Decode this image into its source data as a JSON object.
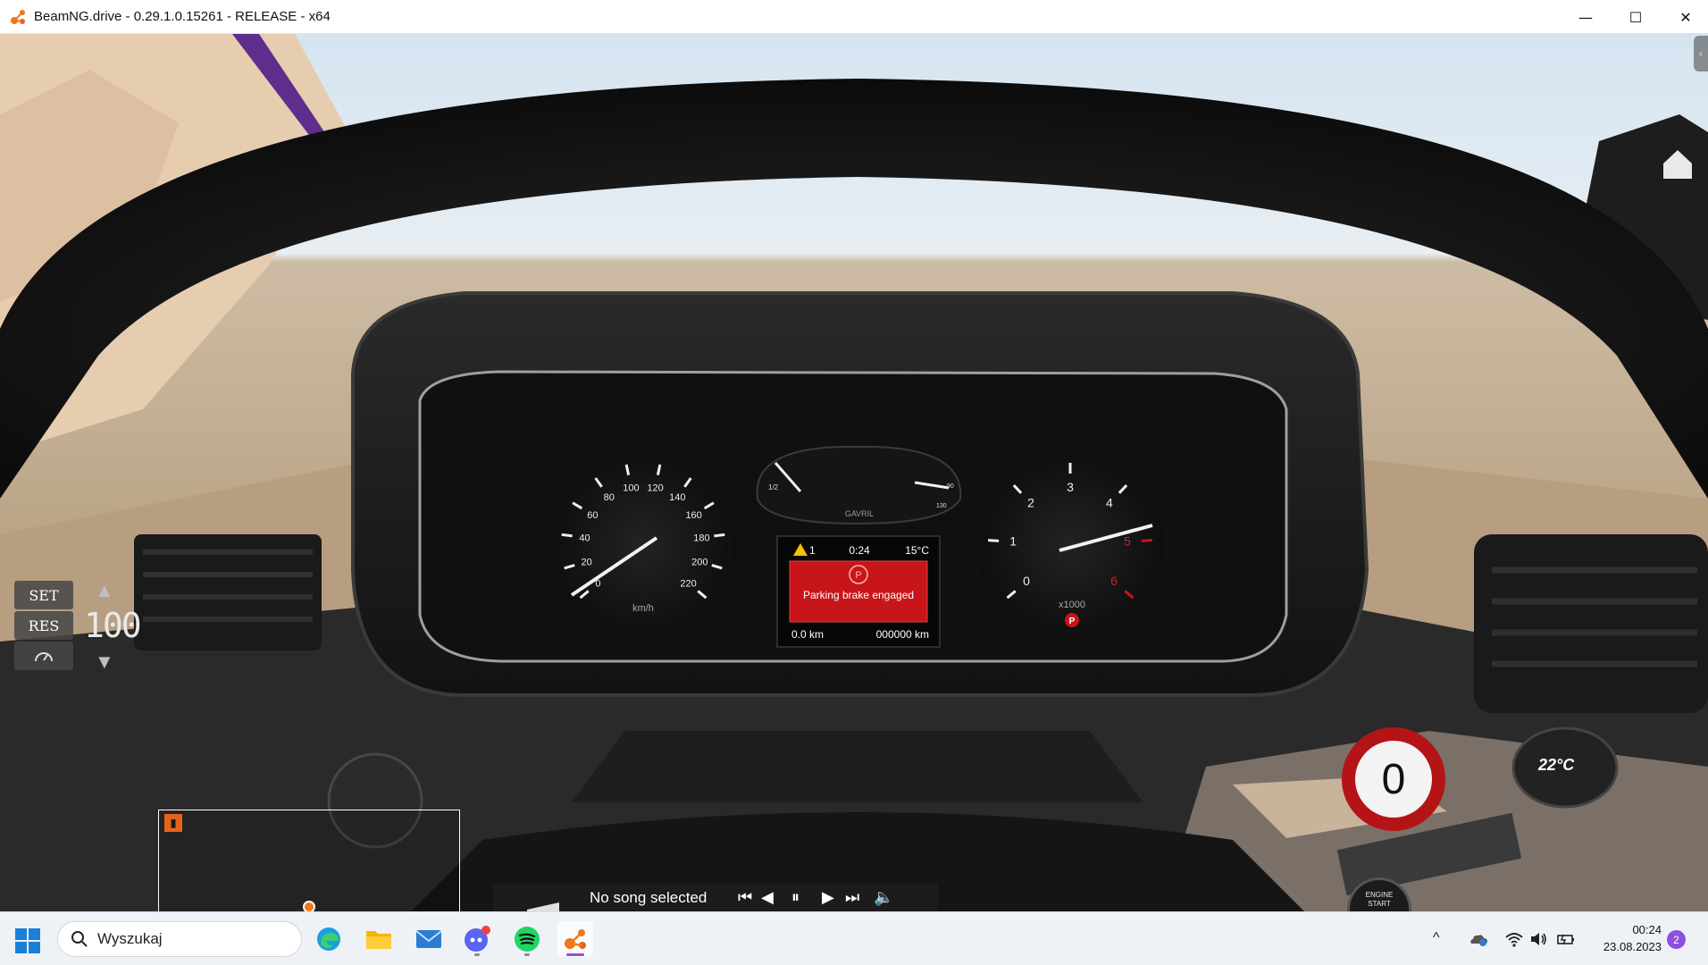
{
  "window": {
    "title": "BeamNG.drive - 0.29.1.0.15261 - RELEASE - x64",
    "minimize_glyph": "—",
    "maximize_glyph": "☐",
    "close_glyph": "✕"
  },
  "cluster": {
    "speedo_ticks": [
      "0",
      "20",
      "40",
      "60",
      "80",
      "100",
      "120",
      "140",
      "160",
      "180",
      "200",
      "220"
    ],
    "speedo_unit": "km/h",
    "tacho_ticks": [
      "0",
      "1",
      "2",
      "3",
      "4",
      "5",
      "6"
    ],
    "tacho_unit": "x1000",
    "mini_gauge_brand": "GAVRIL",
    "fuel_half": "1/2",
    "temp_max": "90",
    "temp_hot": "130",
    "display": {
      "warning_count": "1",
      "time": "0:24",
      "temperature": "15°C",
      "message": "Parking brake engaged",
      "trip": "0.0 km",
      "odometer": "000000 km"
    },
    "parking_symbol": "P"
  },
  "cruise_control": {
    "set_label": "SET",
    "res_label": "RES",
    "speed": "100",
    "up_arrow": "▲",
    "down_arrow": "▼"
  },
  "climate": {
    "temp_label": "22°C"
  },
  "music": {
    "song": "No song selected"
  },
  "speed_limit": {
    "value": "0"
  },
  "engine": {
    "line1": "ENGINE",
    "line2": "START"
  },
  "taskbar": {
    "search_placeholder": "Wyszukaj",
    "clock_time": "00:24",
    "clock_date": "23.08.2023",
    "notification_count": "2",
    "apps": [
      "Edge",
      "File Explorer",
      "Mail",
      "Discord",
      "Spotify",
      "BeamNG.drive"
    ]
  },
  "colors": {
    "speed_limit_ring": "#b51416",
    "warning_red": "#c8151a",
    "map_accent": "#e8621d",
    "badge": "#8e4fe0"
  }
}
